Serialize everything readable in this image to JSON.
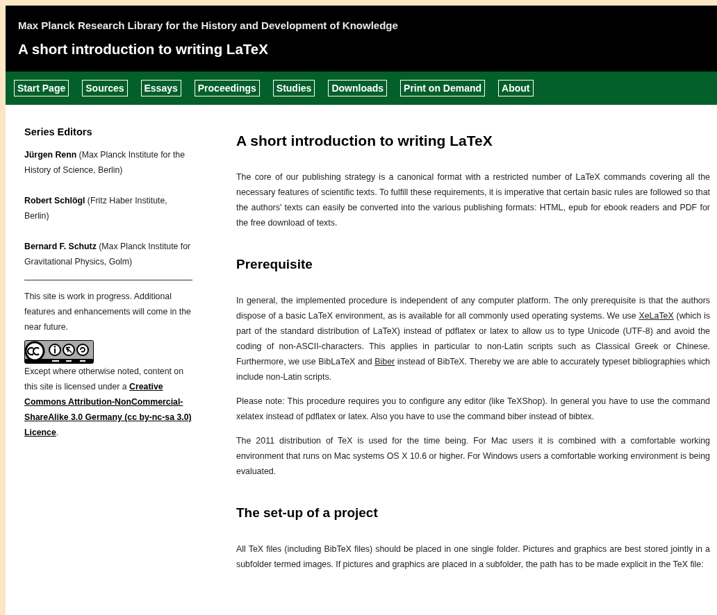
{
  "header": {
    "subtitle": "Max Planck Research Library for the History and Development of Knowledge",
    "title": "A short introduction to writing LaTeX"
  },
  "nav": [
    {
      "label": "Start Page"
    },
    {
      "label": "Sources"
    },
    {
      "label": "Essays"
    },
    {
      "label": "Proceedings"
    },
    {
      "label": "Studies"
    },
    {
      "label": "Downloads"
    },
    {
      "label": "Print on Demand"
    },
    {
      "label": "About"
    }
  ],
  "sidebar": {
    "heading": "Series Editors",
    "editors": [
      "**Jürgen Renn** (Max Planck Institute for the History of Science, Berlin)",
      "**Robert Schlögl** (Fritz Haber Institute, Berlin)",
      "**Bernard F. Schutz** (Max Planck Institute for Gravitational Physics, Golm)"
    ],
    "note": "This site is work in progress. Additional features and enhancements will come in the near future.",
    "license": [
      {
        "kind": "text",
        "text": "Except where otherwise noted, content on this site is licensed under a "
      },
      {
        "kind": "link",
        "text": "Creative"
      },
      {
        "kind": "space"
      },
      {
        "kind": "link",
        "text": "Commons Attribution-NonCommercial-"
      },
      {
        "kind": "link",
        "text": "ShareAlike 3.0 Germany (cc by-nc-sa 3.0)"
      },
      {
        "kind": "space"
      },
      {
        "kind": "link",
        "text": "Licence"
      },
      {
        "kind": "text",
        "text": "."
      }
    ]
  },
  "main": [
    {
      "kind": "h1",
      "text": "A short introduction to writing LaTeX"
    },
    {
      "kind": "p",
      "parts": [
        {
          "kind": "text",
          "text": "The core of our publishing strategy is a canonical format with a restricted number of LaTeX commands covering all the necessary features of scientific texts. To fulfill these requirements, it is imperative that certain basic rules are followed so that the authors' texts can easily be converted into the various publishing formats: HTML, epub for ebook readers and PDF for the free download of texts."
        }
      ]
    },
    {
      "kind": "h2",
      "text": "Prerequisite"
    },
    {
      "kind": "p",
      "parts": [
        {
          "kind": "text",
          "text": "In general, the implemented procedure is independent of any computer platform. The only prerequisite is that the authors dispose of a basic LaTeX environment, as is available for all commonly used operating systems. We use "
        },
        {
          "kind": "link",
          "text": "XeLaTeX"
        },
        {
          "kind": "text",
          "text": " (which is part of the standard distribution of LaTeX) instead of pdflatex or latex to allow us to type Unicode (UTF-8) and avoid the coding of non-ASCII-characters. This applies in particular to non-Latin scripts such as Classical Greek or Chinese. Furthermore, we use BibLaTeX and "
        },
        {
          "kind": "link",
          "text": "Biber"
        },
        {
          "kind": "text",
          "text": " instead of BibTeX. Thereby we are able to accurately typeset bibliographies which include non-Latin scripts."
        }
      ]
    },
    {
      "kind": "p",
      "parts": [
        {
          "kind": "text",
          "text": "Please note: This procedure requires you to configure any editor (like TeXShop). In general you have to use the command xelatex instead of pdflatex or latex. Also you have to use the command biber instead of bibtex."
        }
      ]
    },
    {
      "kind": "p",
      "parts": [
        {
          "kind": "text",
          "text": "The 2011 distribution of TeX is used for the time being. For Mac users it is combined with a comfortable working environment that runs on Mac systems OS X 10.6 or higher. For Windows users a comfortable working environment is being evaluated."
        }
      ]
    },
    {
      "kind": "h2",
      "text": "The set-up of a project"
    },
    {
      "kind": "p",
      "parts": [
        {
          "kind": "text",
          "text": "All TeX files (including BibTeX files) should be placed in one single folder. Pictures and graphics are best stored jointly in a subfolder termed images. If pictures and graphics are placed in a subfolder, the path has to be made explicit in the TeX file:"
        }
      ]
    }
  ]
}
